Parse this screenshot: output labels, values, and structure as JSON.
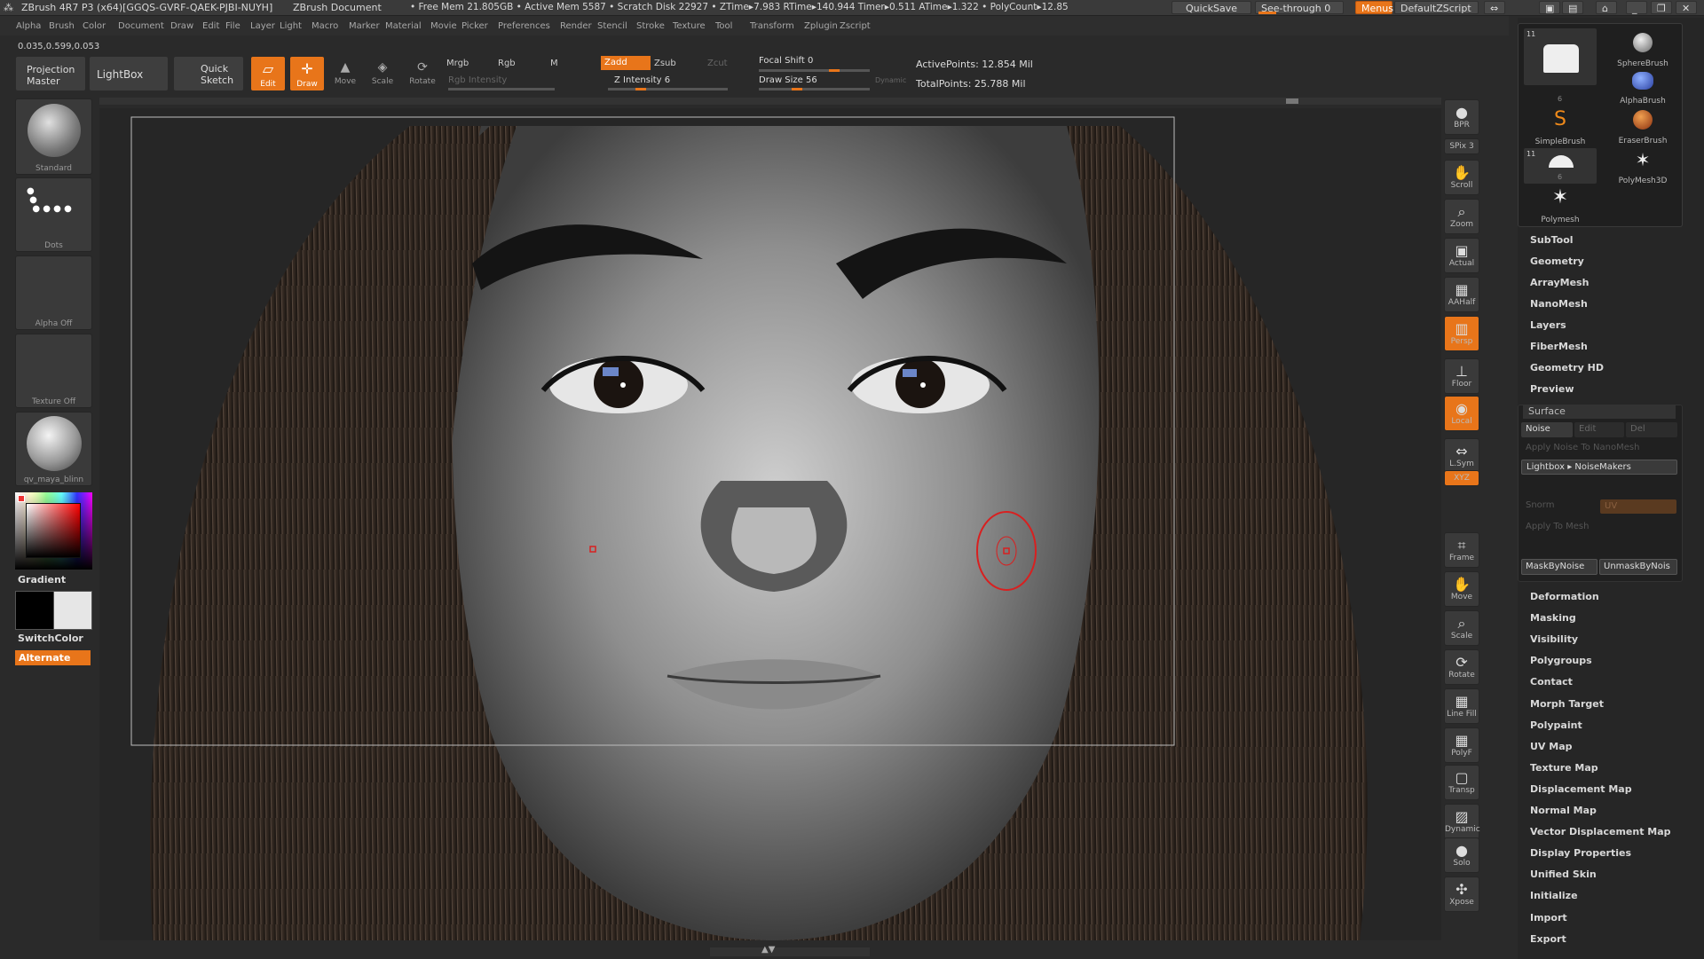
{
  "titlebar": {
    "app_title": "ZBrush 4R7 P3 (x64)[GGQS-GVRF-QAEK-PJBI-NUYH]",
    "document": "ZBrush Document",
    "stats": "• Free Mem 21.805GB • Active Mem 5587 • Scratch Disk 22927 • ZTime▸7.983 RTime▸140.944 Timer▸0.511 ATime▸1.322 • PolyCount▸12.85",
    "quicksave": "QuickSave",
    "see_through": "See-through  0",
    "menus": "Menus",
    "default_zscript": "DefaultZScript"
  },
  "menubar": [
    "Alpha",
    "Brush",
    "Color",
    "Document",
    "Draw",
    "Edit",
    "File",
    "Layer",
    "Light",
    "Macro",
    "Marker",
    "Material",
    "Movie",
    "Picker",
    "Preferences",
    "Render",
    "Stencil",
    "Stroke",
    "Texture",
    "Tool",
    "Transform",
    "Zplugin",
    "Zscript"
  ],
  "coords": "0.035,0.599,0.053",
  "shelf": {
    "projection_master": [
      "Projection",
      "Master"
    ],
    "lightbox": "LightBox",
    "quick_sketch": [
      "Quick",
      "Sketch"
    ],
    "edit": "Edit",
    "draw": "Draw",
    "move": "Move",
    "scale": "Scale",
    "rotate": "Rotate",
    "mrgb": "Mrgb",
    "rgb": "Rgb",
    "m": "M",
    "rgb_intensity": "Rgb Intensity",
    "zadd": "Zadd",
    "zsub": "Zsub",
    "zcut": "Zcut",
    "z_intensity": "Z Intensity 6",
    "focal_shift": "Focal Shift 0",
    "draw_size": "Draw Size 56",
    "dynamic": "Dynamic",
    "active_points": "ActivePoints: 12.854 Mil",
    "total_points": "TotalPoints: 25.788 Mil"
  },
  "leftpanel": {
    "standard": "Standard",
    "dots": "Dots",
    "alpha_off": "Alpha Off",
    "texture_off": "Texture Off",
    "material": "qv_maya_blinn",
    "gradient": "Gradient",
    "switch_color": "SwitchColor",
    "alternate": "Alternate"
  },
  "righttools": [
    {
      "label": "BPR",
      "icon": "bpr-icon"
    },
    {
      "label": "SPix 3",
      "icon": "spix-icon"
    },
    {
      "label": "Scroll",
      "icon": "scroll-icon"
    },
    {
      "label": "Zoom",
      "icon": "zoom-icon"
    },
    {
      "label": "Actual",
      "icon": "actual-icon"
    },
    {
      "label": "AAHalf",
      "icon": "aahalf-icon"
    },
    {
      "label": "Persp",
      "icon": "persp-icon"
    },
    {
      "label": "Floor",
      "icon": "floor-icon"
    },
    {
      "label": "Local",
      "icon": "local-icon"
    },
    {
      "label": "L.Sym",
      "icon": "lsym-icon"
    },
    {
      "label": "XYZ",
      "icon": "xyz-icon"
    },
    {
      "label": "Frame",
      "icon": "frame-icon"
    },
    {
      "label": "Move",
      "icon": "move-icon"
    },
    {
      "label": "Scale",
      "icon": "scale-icon"
    },
    {
      "label": "Rotate",
      "icon": "rotate-icon"
    },
    {
      "label": "Line Fill",
      "icon": "linefill-icon"
    },
    {
      "label": "PolyF",
      "icon": "polyf-icon"
    },
    {
      "label": "Transp",
      "icon": "transp-icon"
    },
    {
      "label": "Dynamic",
      "icon": "dynamic-icon"
    },
    {
      "label": "Solo",
      "icon": "solo-icon"
    },
    {
      "label": "Xpose",
      "icon": "xpose-icon"
    }
  ],
  "tools": {
    "top_left_num": "11",
    "top_left_count": "6",
    "sphere_brush": "SphereBrush",
    "alpha_brush": "AlphaBrush",
    "simple_brush": "SimpleBrush",
    "eraser_brush": "EraserBrush",
    "mid_num": "11",
    "mid_count": "6",
    "polymesh3d": "PolyMesh3D",
    "polymesh": "Polymesh"
  },
  "rightmenu": {
    "top_items": [
      "SubTool",
      "Geometry",
      "ArrayMesh",
      "NanoMesh",
      "Layers",
      "FiberMesh",
      "Geometry HD",
      "Preview"
    ],
    "surface": "Surface",
    "noise": "Noise",
    "edit": "Edit",
    "del": "Del",
    "apply_noise_nano": "Apply Noise To NanoMesh",
    "lightbox_noisemakers": "Lightbox ▸ NoiseMakers",
    "snorm": "Snorm",
    "uv": "UV",
    "apply_to_mesh": "Apply To Mesh",
    "mask_by_noise": "MaskByNoise",
    "unmask_by_noise": "UnmaskByNois",
    "bottom_items": [
      "Deformation",
      "Masking",
      "Visibility",
      "Polygroups",
      "Contact",
      "Morph Target",
      "Polypaint",
      "UV Map",
      "Texture Map",
      "Displacement Map",
      "Normal Map",
      "Vector Displacement Map",
      "Display Properties",
      "Unified Skin",
      "Initialize",
      "Import",
      "Export"
    ]
  },
  "colors": {
    "accent": "#e8751a",
    "panel": "#2a2a2a",
    "button": "#3e3e3e"
  }
}
